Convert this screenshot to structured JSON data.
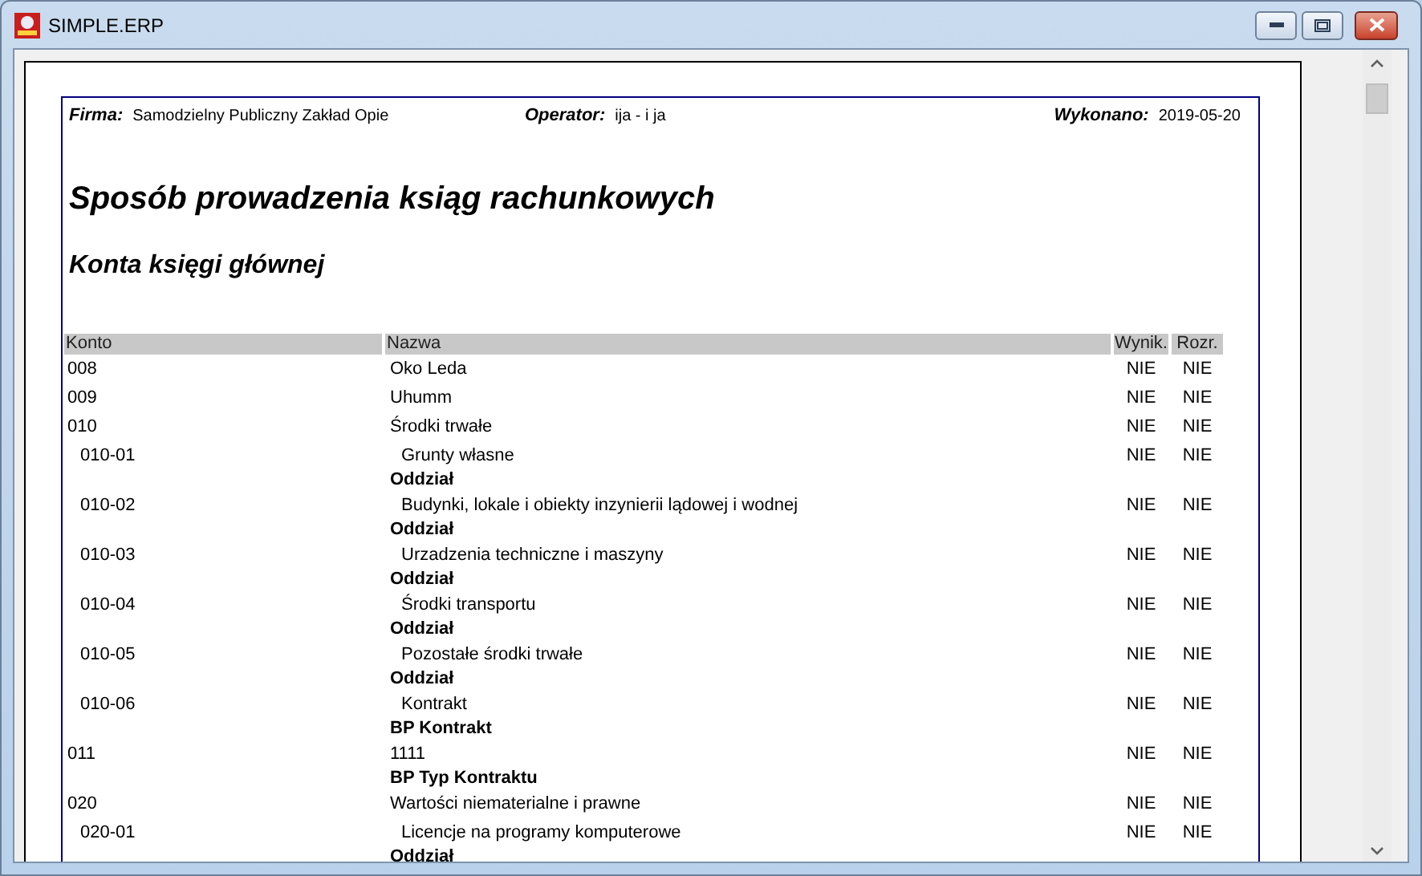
{
  "window": {
    "title": "SIMPLE.ERP"
  },
  "report": {
    "header": [
      {
        "label": "Firma:",
        "value": "Samodzielny Publiczny Zakład Opie"
      },
      {
        "label": "Operator:",
        "value": "ija - i ja"
      },
      {
        "label": "Wykonano:",
        "value": "2019-05-20"
      }
    ],
    "title": "Sposób prowadzenia ksiąg rachunkowych",
    "subtitle": "Konta księgi głównej",
    "table": {
      "columns": [
        "Konto",
        "Nazwa",
        "Wynik.",
        "Rozr."
      ],
      "rows": [
        {
          "konto": "008",
          "nazwa": "Oko Leda",
          "wynik": "NIE",
          "rozr": "NIE"
        },
        {
          "konto": "009",
          "nazwa": "Uhumm",
          "wynik": "NIE",
          "rozr": "NIE"
        },
        {
          "konto": "010",
          "nazwa": "Środki trwałe",
          "wynik": "NIE",
          "rozr": "NIE",
          "children": [
            {
              "konto": "010-01",
              "nazwa": "Grunty własne",
              "wynik": "NIE",
              "rozr": "NIE",
              "note": "Oddział"
            },
            {
              "konto": "010-02",
              "nazwa": "Budynki, lokale i obiekty inzynierii lądowej i wodnej",
              "wynik": "NIE",
              "rozr": "NIE",
              "note": "Oddział"
            },
            {
              "konto": "010-03",
              "nazwa": "Urzadzenia techniczne i maszyny",
              "wynik": "NIE",
              "rozr": "NIE",
              "note": "Oddział"
            },
            {
              "konto": "010-04",
              "nazwa": "Środki transportu",
              "wynik": "NIE",
              "rozr": "NIE",
              "note": "Oddział"
            },
            {
              "konto": "010-05",
              "nazwa": "Pozostałe środki trwałe",
              "wynik": "NIE",
              "rozr": "NIE",
              "note": "Oddział"
            },
            {
              "konto": "010-06",
              "nazwa": "Kontrakt",
              "wynik": "NIE",
              "rozr": "NIE",
              "note": "BP Kontrakt"
            }
          ]
        },
        {
          "konto": "011",
          "nazwa": "1111",
          "wynik": "NIE",
          "rozr": "NIE",
          "note": "BP Typ Kontraktu"
        },
        {
          "konto": "020",
          "nazwa": "Wartości niematerialne i prawne",
          "wynik": "NIE",
          "rozr": "NIE",
          "children": [
            {
              "konto": "020-01",
              "nazwa": "Licencje na programy komputerowe",
              "wynik": "NIE",
              "rozr": "NIE",
              "note": "Oddział"
            }
          ]
        }
      ]
    }
  }
}
